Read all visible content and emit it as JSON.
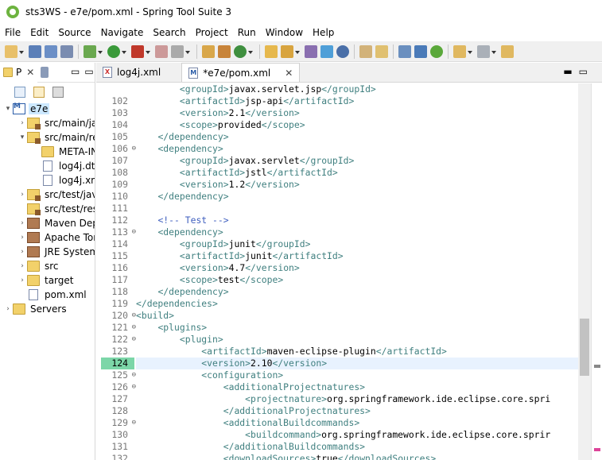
{
  "window": {
    "title": "sts3WS - e7e/pom.xml - Spring Tool Suite 3"
  },
  "menu": [
    "File",
    "Edit",
    "Source",
    "Navigate",
    "Search",
    "Project",
    "Run",
    "Window",
    "Help"
  ],
  "left_panel": {
    "tab_label": "P",
    "tree": [
      {
        "label": "e7e",
        "depth": 0,
        "twisty": "▾",
        "icon": "maven-project-icon",
        "selected": true
      },
      {
        "label": "src/main/ja",
        "depth": 1,
        "twisty": "›",
        "icon": "source-folder-icon"
      },
      {
        "label": "src/main/re",
        "depth": 1,
        "twisty": "▾",
        "icon": "source-folder-icon"
      },
      {
        "label": "META-IN",
        "depth": 2,
        "twisty": "",
        "icon": "folder-icon"
      },
      {
        "label": "log4j.dt",
        "depth": 2,
        "twisty": "",
        "icon": "file-icon"
      },
      {
        "label": "log4j.xm",
        "depth": 2,
        "twisty": "",
        "icon": "xml-file-icon"
      },
      {
        "label": "src/test/jav",
        "depth": 1,
        "twisty": "›",
        "icon": "source-folder-icon"
      },
      {
        "label": "src/test/res",
        "depth": 1,
        "twisty": "",
        "icon": "source-folder-icon"
      },
      {
        "label": "Maven Dep",
        "depth": 1,
        "twisty": "›",
        "icon": "library-icon"
      },
      {
        "label": "Apache Tor",
        "depth": 1,
        "twisty": "›",
        "icon": "library-icon"
      },
      {
        "label": "JRE System",
        "depth": 1,
        "twisty": "›",
        "icon": "library-icon"
      },
      {
        "label": "src",
        "depth": 1,
        "twisty": "›",
        "icon": "folder-icon"
      },
      {
        "label": "target",
        "depth": 1,
        "twisty": "›",
        "icon": "folder-icon"
      },
      {
        "label": "pom.xml",
        "depth": 1,
        "twisty": "",
        "icon": "pom-file-icon"
      },
      {
        "label": "Servers",
        "depth": 0,
        "twisty": "›",
        "icon": "folder-icon"
      }
    ]
  },
  "editor_tabs": [
    {
      "label": "log4j.xml",
      "active": false
    },
    {
      "label": "*e7e/pom.xml",
      "active": true
    }
  ],
  "editor": {
    "current_line": "124",
    "lines": [
      {
        "n": "",
        "fold": "",
        "parts": [
          [
            "i",
            "        "
          ],
          [
            "t",
            "<groupId>"
          ],
          [
            "x",
            "javax.servlet.jsp"
          ],
          [
            "t",
            "</groupId>"
          ]
        ]
      },
      {
        "n": "102",
        "fold": "",
        "parts": [
          [
            "i",
            "        "
          ],
          [
            "t",
            "<artifactId>"
          ],
          [
            "x",
            "jsp-api"
          ],
          [
            "t",
            "</artifactId>"
          ]
        ]
      },
      {
        "n": "103",
        "fold": "",
        "parts": [
          [
            "i",
            "        "
          ],
          [
            "t",
            "<version>"
          ],
          [
            "x",
            "2.1"
          ],
          [
            "t",
            "</version>"
          ]
        ]
      },
      {
        "n": "104",
        "fold": "",
        "parts": [
          [
            "i",
            "        "
          ],
          [
            "t",
            "<scope>"
          ],
          [
            "x",
            "provided"
          ],
          [
            "t",
            "</scope>"
          ]
        ]
      },
      {
        "n": "105",
        "fold": "",
        "parts": [
          [
            "i",
            "    "
          ],
          [
            "t",
            "</dependency>"
          ]
        ]
      },
      {
        "n": "106",
        "fold": "⊖",
        "parts": [
          [
            "i",
            "    "
          ],
          [
            "t",
            "<dependency>"
          ]
        ]
      },
      {
        "n": "107",
        "fold": "",
        "parts": [
          [
            "i",
            "        "
          ],
          [
            "t",
            "<groupId>"
          ],
          [
            "x",
            "javax.servlet"
          ],
          [
            "t",
            "</groupId>"
          ]
        ]
      },
      {
        "n": "108",
        "fold": "",
        "parts": [
          [
            "i",
            "        "
          ],
          [
            "t",
            "<artifactId>"
          ],
          [
            "x",
            "jstl"
          ],
          [
            "t",
            "</artifactId>"
          ]
        ]
      },
      {
        "n": "109",
        "fold": "",
        "parts": [
          [
            "i",
            "        "
          ],
          [
            "t",
            "<version>"
          ],
          [
            "x",
            "1.2"
          ],
          [
            "t",
            "</version>"
          ]
        ]
      },
      {
        "n": "110",
        "fold": "",
        "parts": [
          [
            "i",
            "    "
          ],
          [
            "t",
            "</dependency>"
          ]
        ]
      },
      {
        "n": "111",
        "fold": "",
        "parts": []
      },
      {
        "n": "112",
        "fold": "",
        "parts": [
          [
            "i",
            "    "
          ],
          [
            "c",
            "<!-- Test -->"
          ]
        ]
      },
      {
        "n": "113",
        "fold": "⊖",
        "parts": [
          [
            "i",
            "    "
          ],
          [
            "t",
            "<dependency>"
          ]
        ]
      },
      {
        "n": "114",
        "fold": "",
        "parts": [
          [
            "i",
            "        "
          ],
          [
            "t",
            "<groupId>"
          ],
          [
            "x",
            "junit"
          ],
          [
            "t",
            "</groupId>"
          ]
        ]
      },
      {
        "n": "115",
        "fold": "",
        "parts": [
          [
            "i",
            "        "
          ],
          [
            "t",
            "<artifactId>"
          ],
          [
            "x",
            "junit"
          ],
          [
            "t",
            "</artifactId>"
          ]
        ]
      },
      {
        "n": "116",
        "fold": "",
        "parts": [
          [
            "i",
            "        "
          ],
          [
            "t",
            "<version>"
          ],
          [
            "x",
            "4.7"
          ],
          [
            "t",
            "</version>"
          ]
        ]
      },
      {
        "n": "117",
        "fold": "",
        "parts": [
          [
            "i",
            "        "
          ],
          [
            "t",
            "<scope>"
          ],
          [
            "x",
            "test"
          ],
          [
            "t",
            "</scope>"
          ]
        ]
      },
      {
        "n": "118",
        "fold": "",
        "parts": [
          [
            "i",
            "    "
          ],
          [
            "t",
            "</dependency>"
          ]
        ]
      },
      {
        "n": "119",
        "fold": "",
        "parts": [
          [
            "i",
            ""
          ],
          [
            "t",
            "</dependencies>"
          ]
        ]
      },
      {
        "n": "120",
        "fold": "⊖",
        "parts": [
          [
            "i",
            ""
          ],
          [
            "t",
            "<build>"
          ]
        ]
      },
      {
        "n": "121",
        "fold": "⊖",
        "parts": [
          [
            "i",
            "    "
          ],
          [
            "t",
            "<plugins>"
          ]
        ]
      },
      {
        "n": "122",
        "fold": "⊖",
        "parts": [
          [
            "i",
            "        "
          ],
          [
            "t",
            "<plugin>"
          ]
        ]
      },
      {
        "n": "123",
        "fold": "",
        "parts": [
          [
            "i",
            "            "
          ],
          [
            "t",
            "<artifactId>"
          ],
          [
            "x",
            "maven-eclipse-plugin"
          ],
          [
            "t",
            "</artifactId>"
          ]
        ]
      },
      {
        "n": "124",
        "fold": "",
        "parts": [
          [
            "i",
            "            "
          ],
          [
            "t",
            "<version>"
          ],
          [
            "x",
            "2.10"
          ],
          [
            "t",
            "</version>"
          ]
        ]
      },
      {
        "n": "125",
        "fold": "⊖",
        "parts": [
          [
            "i",
            "            "
          ],
          [
            "t",
            "<configuration>"
          ]
        ]
      },
      {
        "n": "126",
        "fold": "⊖",
        "parts": [
          [
            "i",
            "                "
          ],
          [
            "t",
            "<additionalProjectnatures>"
          ]
        ]
      },
      {
        "n": "127",
        "fold": "",
        "parts": [
          [
            "i",
            "                    "
          ],
          [
            "t",
            "<projectnature>"
          ],
          [
            "x",
            "org.springframework.ide.eclipse.core.spri"
          ]
        ]
      },
      {
        "n": "128",
        "fold": "",
        "parts": [
          [
            "i",
            "                "
          ],
          [
            "t",
            "</additionalProjectnatures>"
          ]
        ]
      },
      {
        "n": "129",
        "fold": "⊖",
        "parts": [
          [
            "i",
            "                "
          ],
          [
            "t",
            "<additionalBuildcommands>"
          ]
        ]
      },
      {
        "n": "130",
        "fold": "",
        "parts": [
          [
            "i",
            "                    "
          ],
          [
            "t",
            "<buildcommand>"
          ],
          [
            "x",
            "org.springframework.ide.eclipse.core.sprir"
          ]
        ]
      },
      {
        "n": "131",
        "fold": "",
        "parts": [
          [
            "i",
            "                "
          ],
          [
            "t",
            "</additionalBuildcommands>"
          ]
        ]
      },
      {
        "n": "132",
        "fold": "",
        "parts": [
          [
            "i",
            "                "
          ],
          [
            "t",
            "<downloadSources>"
          ],
          [
            "x",
            "true"
          ],
          [
            "t",
            "</downloadSources>"
          ]
        ]
      }
    ]
  }
}
